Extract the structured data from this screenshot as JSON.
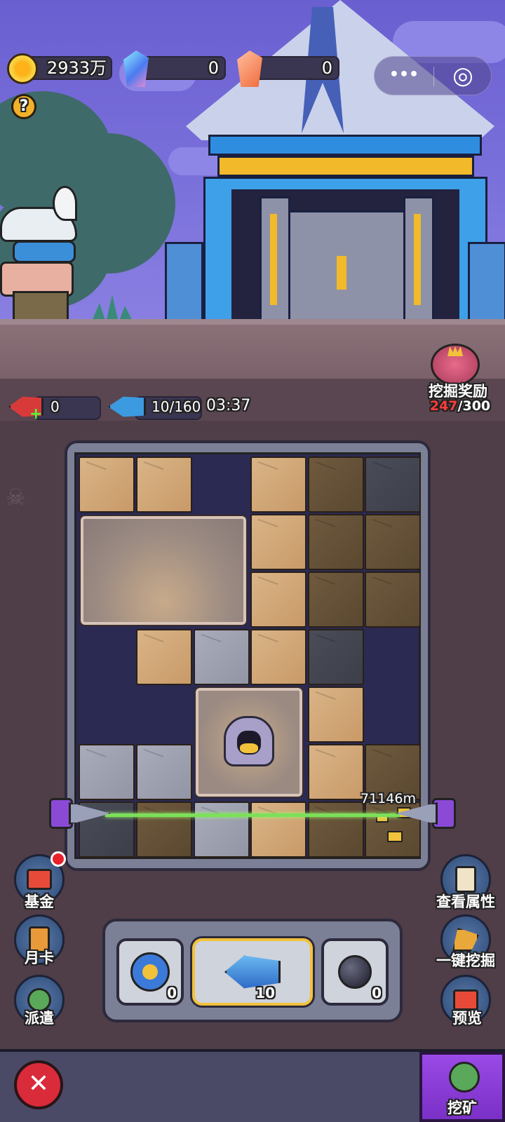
{
  "resources": [
    {
      "icon": "gold-coin-icon",
      "value": "2933万"
    },
    {
      "icon": "blue-crystal-icon",
      "value": "0"
    },
    {
      "icon": "orange-crystal-icon",
      "value": "0"
    }
  ],
  "miniprogram": {
    "more": "•••",
    "close": "◎"
  },
  "help": "?",
  "drills": {
    "repair_count": "0",
    "drill_count": "10/160",
    "timer": "03:37"
  },
  "dig_reward": {
    "label": "挖掘奖励",
    "current": "247",
    "total": "/300"
  },
  "depth": "71146m",
  "left_menu": [
    {
      "label": "基金",
      "icon": "gift-box-icon",
      "badge": true
    },
    {
      "label": "月卡",
      "icon": "month-card-icon",
      "badge": false
    },
    {
      "label": "派遣",
      "icon": "goblin-icon",
      "badge": false
    }
  ],
  "right_menu": [
    {
      "label": "查看属性",
      "icon": "scroll-icon"
    },
    {
      "label": "一键挖掘",
      "icon": "excavator-icon"
    },
    {
      "label": "预览",
      "icon": "gift-box-icon"
    }
  ],
  "tools": [
    {
      "name": "detector",
      "icon": "radar-icon",
      "count": "0"
    },
    {
      "name": "drill",
      "icon": "drill-icon",
      "count": "10"
    },
    {
      "name": "bomb",
      "icon": "bomb-icon",
      "count": "0"
    }
  ],
  "bottom": {
    "close": "✕",
    "mine_label": "挖矿"
  },
  "colors": {
    "accent_purple": "#8a3fd6",
    "close_red": "#d92b3a",
    "reward_red": "#ff3b3b",
    "tool_selected": "#f2c23a"
  }
}
